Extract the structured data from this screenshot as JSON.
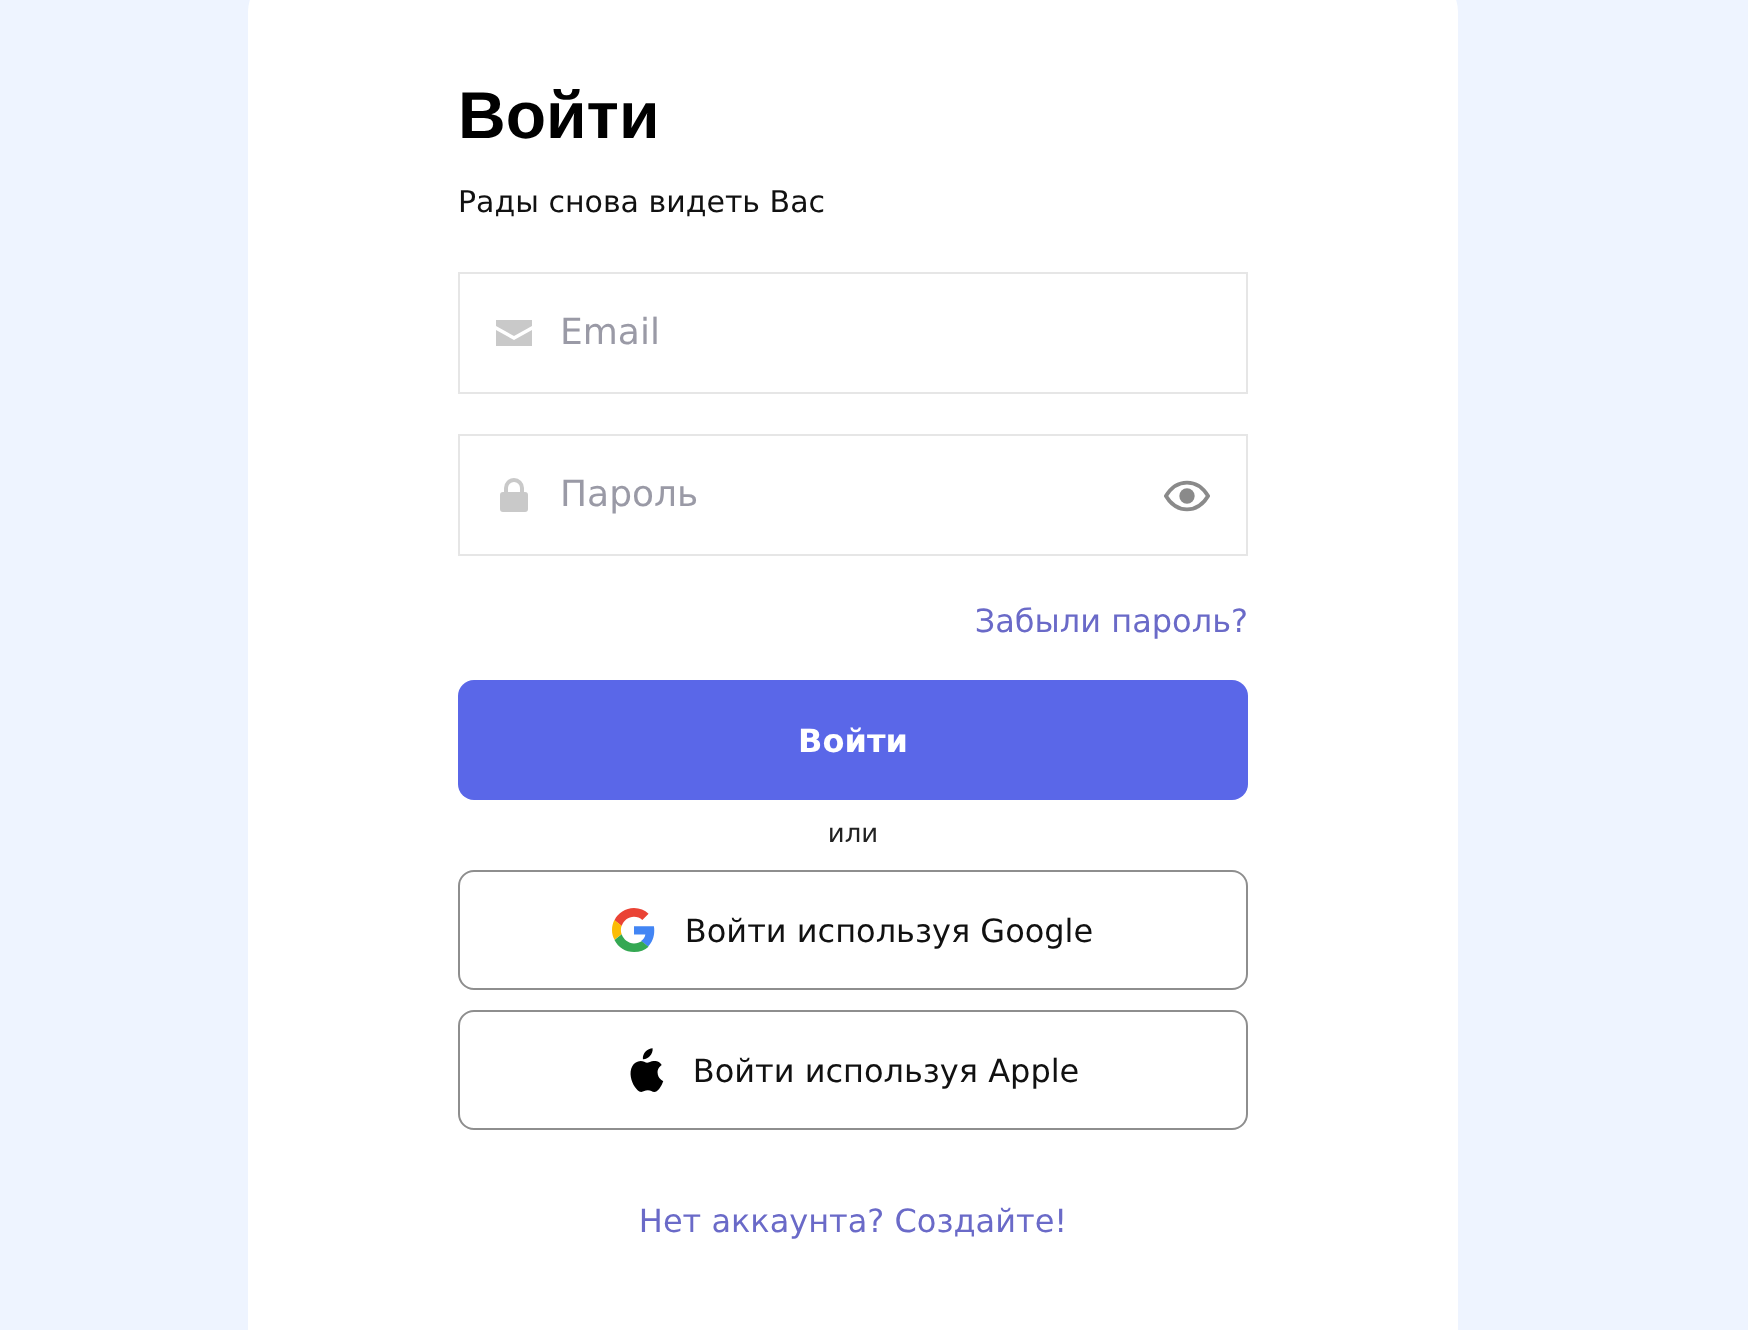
{
  "title": "Войти",
  "subtitle": "Рады снова видеть Вас",
  "fields": [
    {
      "kind": "email",
      "placeholder": "Email"
    },
    {
      "kind": "password",
      "placeholder": "Пароль"
    }
  ],
  "forgot_link": "Забыли пароль?",
  "submit_button": "Войти",
  "divider": "или",
  "social_buttons": [
    {
      "kind": "google",
      "label": "Войти используя Google"
    },
    {
      "kind": "apple",
      "label": "Войти используя Apple"
    }
  ],
  "signup_link": "Нет аккаунта? Создайте!"
}
